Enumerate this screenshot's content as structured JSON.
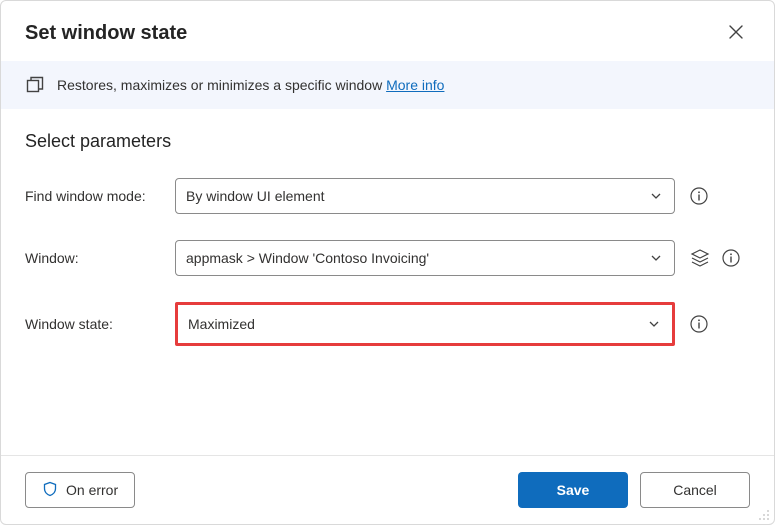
{
  "dialog": {
    "title": "Set window state",
    "info_text": "Restores, maximizes or minimizes a specific window",
    "more_info_label": "More info"
  },
  "section_title": "Select parameters",
  "fields": {
    "find_mode": {
      "label": "Find window mode:",
      "value": "By window UI element"
    },
    "window": {
      "label": "Window:",
      "value": "appmask > Window 'Contoso Invoicing'"
    },
    "state": {
      "label": "Window state:",
      "value": "Maximized"
    }
  },
  "footer": {
    "on_error_label": "On error",
    "save_label": "Save",
    "cancel_label": "Cancel"
  }
}
